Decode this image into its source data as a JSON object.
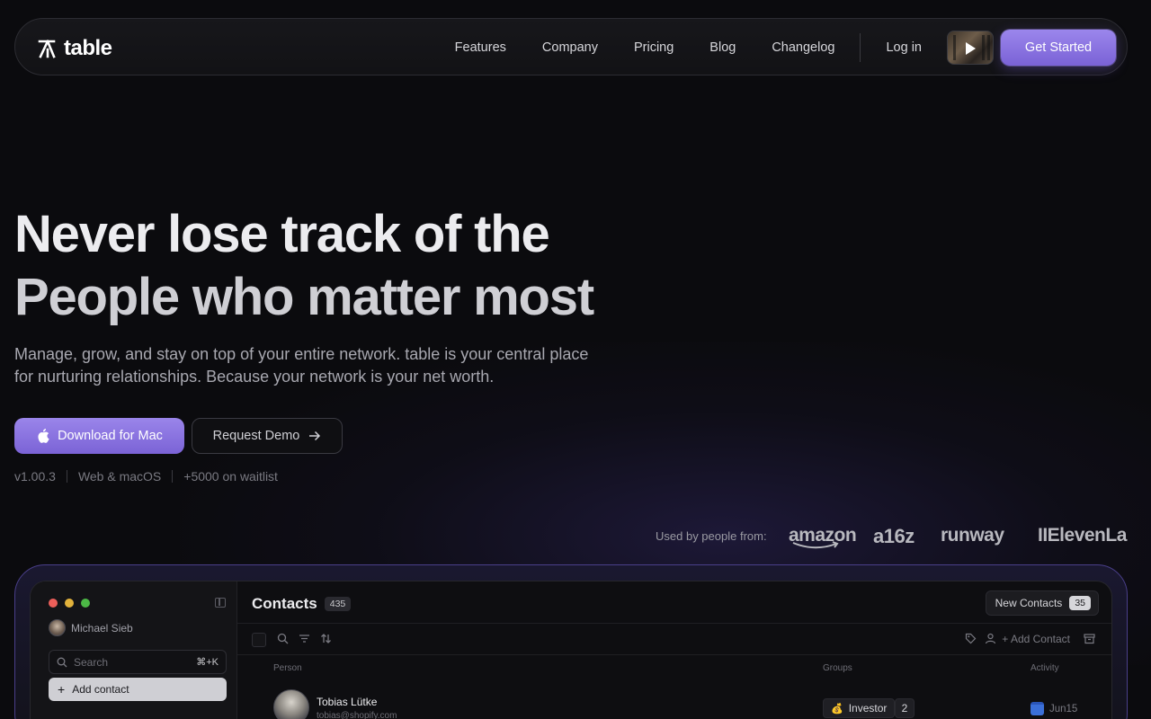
{
  "nav": {
    "logo_text": "table",
    "links": [
      "Features",
      "Company",
      "Pricing",
      "Blog",
      "Changelog"
    ],
    "login": "Log in",
    "cta": "Get Started"
  },
  "hero": {
    "title_line1": "Never lose track of the",
    "title_line2": "People who matter most",
    "subtitle_line1": "Manage, grow, and stay on top of your entire network. table is your central place",
    "subtitle_line2": "for nurturing relationships. Because your network is your net worth.",
    "primary_button": "Download for Mac",
    "secondary_button": "Request Demo",
    "meta": [
      "v1.00.3",
      "Web & macOS",
      "+5000 on waitlist"
    ]
  },
  "brands": {
    "label": "Used by people from:",
    "names": [
      "amazon",
      "a16z",
      "runway",
      "IIElevenLabs"
    ]
  },
  "app": {
    "user_name": "Michael Sieb",
    "search_placeholder": "Search",
    "search_shortcut": "⌘+K",
    "add_contact": "Add contact",
    "contacts_title": "Contacts",
    "contacts_count": "435",
    "new_contacts_label": "New Contacts",
    "new_contacts_count": "35",
    "toolbar_add": "+ Add Contact",
    "columns": [
      "Person",
      "Groups",
      "Activity"
    ],
    "row": {
      "name": "Tobias Lütke",
      "email": "tobias@shopify.com",
      "group": "Investor",
      "group_count": "2",
      "activity": "Jun15"
    }
  },
  "colors": {
    "accent": "#8a73e2",
    "background": "#0b0b0e"
  }
}
